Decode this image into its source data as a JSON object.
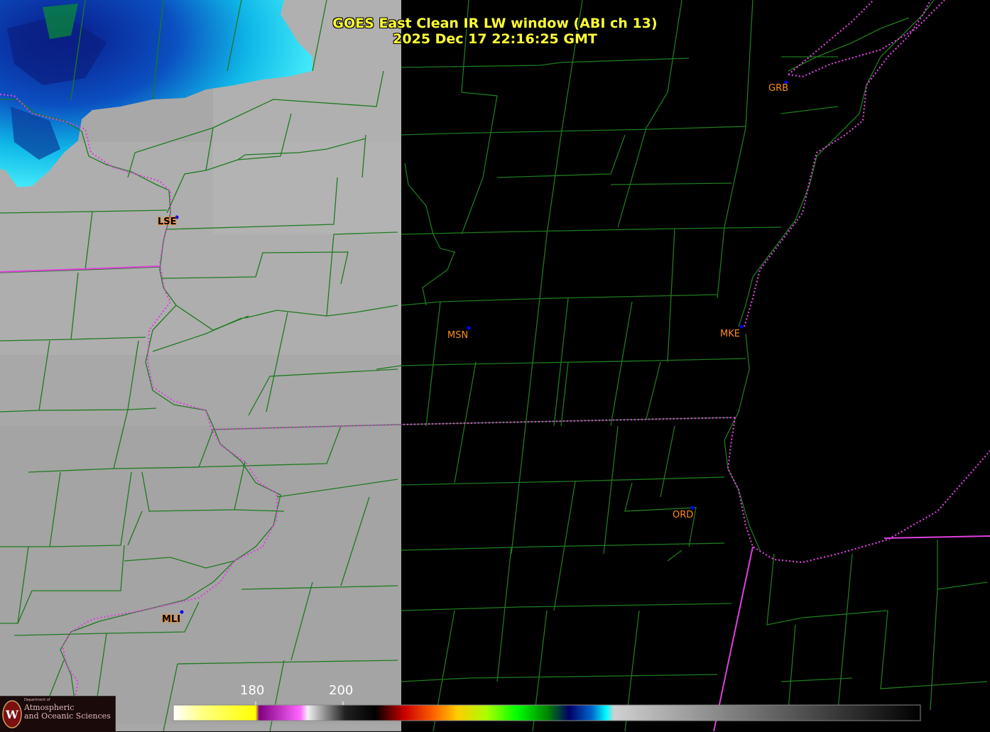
{
  "title": {
    "line1": "GOES East Clean IR LW window (ABI ch 13)",
    "line2": "2025 Dec 17  22:16:25 GMT"
  },
  "stations": [
    {
      "id": "GRB",
      "boxed": false
    },
    {
      "id": "LSE",
      "boxed": true
    },
    {
      "id": "MSN",
      "boxed": false
    },
    {
      "id": "MKE",
      "boxed": false
    },
    {
      "id": "ORD",
      "boxed": false
    },
    {
      "id": "MLI",
      "boxed": true
    }
  ],
  "colorbar": {
    "tick_labels": [
      "180",
      "200"
    ]
  },
  "logo": {
    "department_of": "Department of",
    "line1": "Atmospheric",
    "line2": "and Oceanic Sciences",
    "emblem": "uw-crest-icon"
  },
  "colors": {
    "county_lines": "#1e7a1e",
    "state_borders": "#e040e0",
    "station_label": "#ff8c1a",
    "station_dot": "#0000ff",
    "title": "#ffff33"
  }
}
